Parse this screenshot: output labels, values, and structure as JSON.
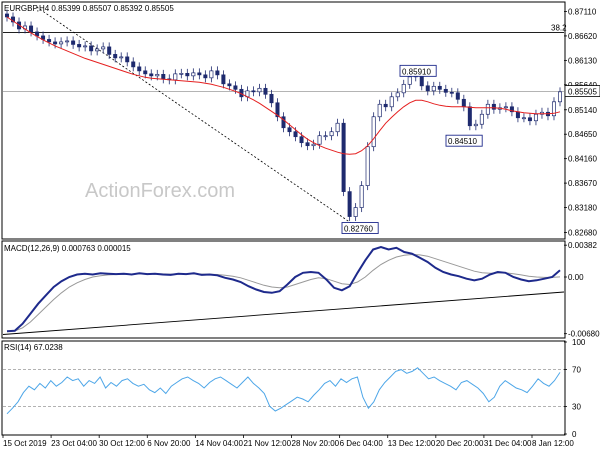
{
  "chart_data": [
    {
      "type": "candlestick",
      "panel": "price",
      "header": "EURGBP,H4  0.85399 0.85507 0.85392 0.85505",
      "watermark": "ActionForex.com",
      "ylim": [
        0.8257,
        0.8728
      ],
      "y_ticks": [
        "0.87110",
        "0.86620",
        "0.86130",
        "0.85640",
        "0.85140",
        "0.84650",
        "0.84160",
        "0.83670",
        "0.83180",
        "0.82680"
      ],
      "fib_label": "38.2",
      "fib_level": 0.8669,
      "last_price_label": "0.85505",
      "last_price": 0.85505,
      "annotations": [
        {
          "label": "0.85910",
          "value": 0.8591
        },
        {
          "label": "0.84510",
          "value": 0.8451
        },
        {
          "label": "0.82760",
          "value": 0.8276
        }
      ],
      "close_series": [
        0.87,
        0.869,
        0.8676,
        0.8682,
        0.867,
        0.8662,
        0.8655,
        0.865,
        0.8646,
        0.865,
        0.8652,
        0.8645,
        0.864,
        0.8642,
        0.8632,
        0.8636,
        0.864,
        0.8625,
        0.8618,
        0.862,
        0.861,
        0.86,
        0.8592,
        0.8586,
        0.8582,
        0.8585,
        0.8576,
        0.8574,
        0.8586,
        0.8587,
        0.8582,
        0.8588,
        0.8584,
        0.8578,
        0.8592,
        0.8584,
        0.8566,
        0.8562,
        0.8555,
        0.854,
        0.8552,
        0.855,
        0.8557,
        0.8545,
        0.8528,
        0.85,
        0.8478,
        0.847,
        0.846,
        0.8448,
        0.8442,
        0.8445,
        0.8462,
        0.8462,
        0.847,
        0.8487,
        0.835,
        0.83,
        0.8318,
        0.8362,
        0.844,
        0.85,
        0.8525,
        0.852,
        0.854,
        0.8548,
        0.8565,
        0.858,
        0.8586,
        0.8562,
        0.8552,
        0.8561,
        0.8555,
        0.8549,
        0.8548,
        0.8535,
        0.852,
        0.8482,
        0.8485,
        0.8505,
        0.8525,
        0.8515,
        0.8518,
        0.852,
        0.851,
        0.8498,
        0.8498,
        0.8492,
        0.8505,
        0.8509,
        0.8502,
        0.853,
        0.855
      ],
      "ma_series": [
        0.87,
        0.8692,
        0.8684,
        0.8676,
        0.8668,
        0.8661,
        0.8654,
        0.8648,
        0.8642,
        0.8637,
        0.8632,
        0.8627,
        0.8622,
        0.8617,
        0.8613,
        0.8609,
        0.8605,
        0.8601,
        0.8597,
        0.8593,
        0.8589,
        0.8585,
        0.8582,
        0.8579,
        0.8577,
        0.8576,
        0.8575,
        0.8574,
        0.8573,
        0.8572,
        0.8571,
        0.857,
        0.8569,
        0.8567,
        0.8565,
        0.8562,
        0.8559,
        0.8555,
        0.8551,
        0.8546,
        0.854,
        0.8534,
        0.8527,
        0.8519,
        0.8511,
        0.8503,
        0.8494,
        0.8484,
        0.8474,
        0.8464,
        0.8455,
        0.8448,
        0.8442,
        0.8437,
        0.8433,
        0.8429,
        0.8426,
        0.8425,
        0.8426,
        0.8432,
        0.8442,
        0.8456,
        0.8472,
        0.8487,
        0.8499,
        0.851,
        0.852,
        0.8528,
        0.8533,
        0.8533,
        0.853,
        0.8526,
        0.8523,
        0.8521,
        0.852,
        0.852,
        0.852,
        0.8519,
        0.8518,
        0.8518,
        0.8518,
        0.8518,
        0.8517,
        0.8515,
        0.8512,
        0.851,
        0.8508,
        0.8507,
        0.8506,
        0.8506,
        0.8506,
        0.8507,
        0.851
      ],
      "trendline": {
        "x0": 0.06,
        "y0": 0.872,
        "x1": 0.64,
        "y1": 0.8272
      }
    },
    {
      "type": "line",
      "panel": "macd",
      "header": "MACD(12,26,9) 0.000763 0.000015",
      "ylim": [
        -0.0072,
        0.0042
      ],
      "y_ticks": [
        "0.00382",
        "0.00",
        "-0.006803"
      ],
      "series": [
        {
          "values": [
            -0.0065,
            -0.00645,
            -0.0056,
            -0.0044,
            -0.0032,
            -0.0022,
            -0.0012,
            -0.0005,
            0.0,
            0.0003,
            0.0004,
            0.0003,
            0.00045,
            0.0004,
            0.00035,
            0.0004,
            0.0003,
            0.00045,
            0.00035,
            0.0004,
            0.0003,
            0.00025,
            0.0004,
            0.00035,
            0.00045,
            0.00025,
            0.0003,
            0.0002,
            -0.0001,
            -0.0003,
            -0.0006,
            -0.0011,
            -0.0015,
            -0.0018,
            -0.0019,
            -0.0017,
            -0.0009,
            0.0,
            0.0005,
            0.0006,
            0.0005,
            -0.0003,
            -0.0013,
            -0.0016,
            -0.0011,
            0.0005,
            0.002,
            0.0033,
            0.0036,
            0.0033,
            0.0035,
            0.003,
            0.0028,
            0.0023,
            0.0018,
            0.0011,
            0.0006,
            0.0003,
            0.0001,
            -0.0002,
            -0.0004,
            -0.0002,
            0.0003,
            0.0006,
            0.0005,
            0.0,
            -0.0003,
            -0.0005,
            -0.0004,
            -0.0002,
            0.0,
            0.0008
          ]
        },
        {
          "values": [
            -0.0065,
            -0.00648,
            -0.0061,
            -0.0054,
            -0.0045,
            -0.0036,
            -0.0027,
            -0.0019,
            -0.0012,
            -0.0007,
            -0.0003,
            0.0,
            0.00015,
            0.00025,
            0.0003,
            0.00033,
            0.00035,
            0.00037,
            0.00038,
            0.00038,
            0.00037,
            0.00035,
            0.00036,
            0.00036,
            0.00037,
            0.00035,
            0.00034,
            0.0003,
            0.0002,
            0.0001,
            -0.0001,
            -0.0004,
            -0.0007,
            -0.001,
            -0.0012,
            -0.0013,
            -0.0012,
            -0.0009,
            -0.0006,
            -0.0003,
            -0.0001,
            -0.0002,
            -0.0005,
            -0.0008,
            -0.0009,
            -0.0006,
            0.0,
            0.0008,
            0.0015,
            0.002,
            0.0024,
            0.0026,
            0.0027,
            0.00265,
            0.0025,
            0.0022,
            0.0019,
            0.0016,
            0.0013,
            0.001,
            0.0007,
            0.0005,
            0.00045,
            0.00048,
            0.0005,
            0.0004,
            0.00025,
            0.0001,
            0.0,
            -5e-05,
            -5e-05,
            1e-05
          ]
        }
      ],
      "trendline": {
        "x0": 0.0,
        "y0": -0.0069,
        "x1": 1.0,
        "y1": -0.0018
      }
    },
    {
      "type": "line",
      "panel": "rsi",
      "header": "RSI(14) 67.0238",
      "ylim": [
        0,
        100
      ],
      "y_ticks": [
        "100",
        "70",
        "30",
        "0"
      ],
      "levels": [
        70,
        30
      ],
      "series": [
        {
          "values": [
            22,
            28,
            35,
            45,
            52,
            48,
            55,
            50,
            58,
            52,
            56,
            62,
            58,
            60,
            52,
            58,
            55,
            62,
            50,
            56,
            52,
            58,
            60,
            55,
            52,
            54,
            48,
            45,
            50,
            44,
            52,
            56,
            60,
            62,
            58,
            55,
            50,
            56,
            60,
            62,
            58,
            54,
            50,
            56,
            62,
            55,
            50,
            44,
            30,
            25,
            28,
            32,
            36,
            40,
            38,
            35,
            42,
            48,
            55,
            58,
            52,
            60,
            56,
            60,
            62,
            40,
            28,
            35,
            48,
            56,
            62,
            68,
            70,
            66,
            68,
            72,
            66,
            60,
            62,
            58,
            55,
            52,
            48,
            56,
            58,
            54,
            50,
            44,
            35,
            40,
            52,
            58,
            54,
            50,
            48,
            45,
            52,
            60,
            55,
            52,
            58,
            67
          ]
        }
      ]
    }
  ],
  "x_labels": [
    "15 Oct 2019",
    "23 Oct 04:00",
    "30 Oct 12:00",
    "6 Nov 20:00",
    "14 Nov 04:00",
    "21 Nov 12:00",
    "28 Nov 20:00",
    "6 Dec 04:00",
    "13 Dec 12:00",
    "20 Dec 20:00",
    "31 Dec 04:00",
    "8 Jan 12:00"
  ],
  "colors": {
    "candle": "#1e2a6e",
    "ma": "#e52020",
    "macd": "#1e2a8c",
    "signal": "#999999",
    "rsi": "#4da6e8",
    "label_border": "#1e2a8c",
    "last_price_bg": "#ffffff"
  }
}
